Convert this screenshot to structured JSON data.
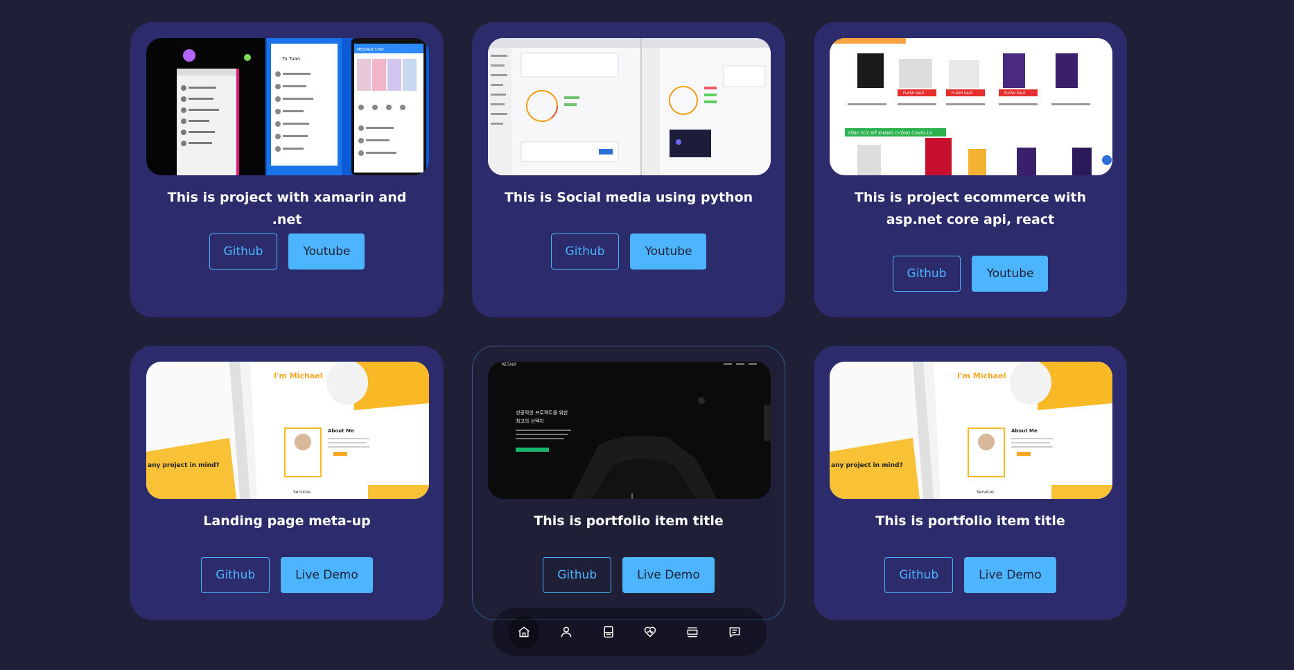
{
  "projects": [
    {
      "title": "This is project with xamarin and .net",
      "buttons": [
        "Github",
        "Youtube"
      ],
      "thumbnail": "xamarin-chat-app"
    },
    {
      "title": "This is Social media using python",
      "buttons": [
        "Github",
        "Youtube"
      ],
      "thumbnail": "social-media-app"
    },
    {
      "title": "This is project ecommerce with asp.net core api, react",
      "buttons": [
        "Github",
        "Youtube"
      ],
      "thumbnail": "ecommerce-store"
    },
    {
      "title": "Landing page meta-up",
      "buttons": [
        "Github",
        "Live Demo"
      ],
      "thumbnail": "landing-page-michael"
    },
    {
      "title": "This is portfolio item title",
      "buttons": [
        "Github",
        "Live Demo"
      ],
      "thumbnail": "dark-landing-page"
    },
    {
      "title": "This is portfolio item title",
      "buttons": [
        "Github",
        "Live Demo"
      ],
      "thumbnail": "landing-page-michael"
    }
  ],
  "thumb_text": {
    "chat_header": "Tu Tuan",
    "message_chat": "MESSAGE CHAT",
    "michael": "I'm Michael",
    "about": "About Me",
    "project": "any project in mind?",
    "services": "Services",
    "flash": "FLASH SALE",
    "covid": "TĂNG SỨC ĐỀ KHÁNG CHỐNG COVID-19",
    "metaup": "METAUP",
    "korean_1": "성공적인 프로젝트를 위한",
    "korean_2": "최고의 선택지"
  },
  "nav": {
    "items": [
      "home-icon",
      "about-icon",
      "experience-icon",
      "services-icon",
      "portfolio-icon",
      "contact-icon"
    ],
    "active": "home-icon"
  },
  "colors": {
    "background": "#1f1f38",
    "card": "#2c2c6c",
    "accent": "#4db5ff"
  }
}
